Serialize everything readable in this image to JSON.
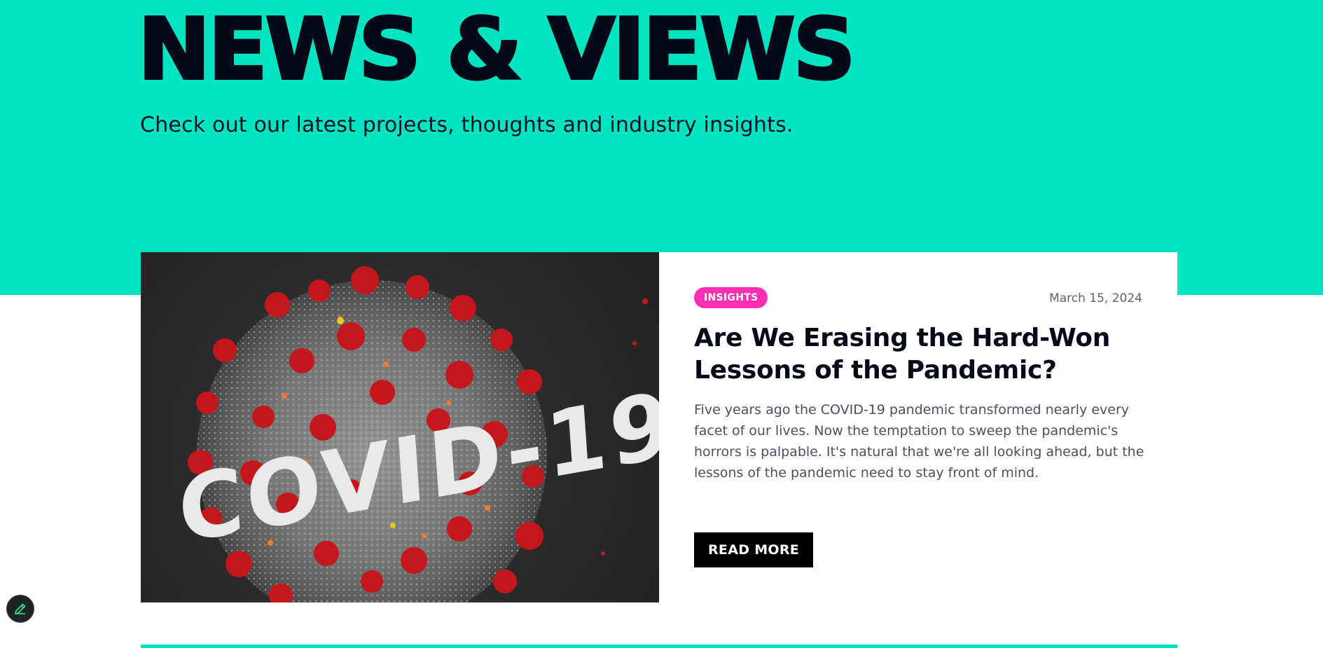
{
  "hero": {
    "title": "NEWS & VIEWS",
    "subtitle": "Check out our latest projects, thoughts and industry insights.",
    "background_color": "#02e3c2"
  },
  "featured_post": {
    "image_alt": "COVID-19",
    "image_text": "COVID-19",
    "category": "INSIGHTS",
    "date": "March 15, 2024",
    "title": "Are We Erasing the Hard-Won Lessons of the Pandemic?",
    "excerpt": "Five years ago the COVID-19 pandemic transformed nearly every facet of our lives. Now the temptation to sweep the pandemic's horrors is palpable. It's natural that we're all looking ahead, but the lessons of the pandemic need to stay front of mind.",
    "read_more_label": "READ MORE",
    "tag_color": "#ff2fb4"
  },
  "edit_button": {
    "icon": "pencil-icon",
    "icon_color": "#2ee68a"
  }
}
